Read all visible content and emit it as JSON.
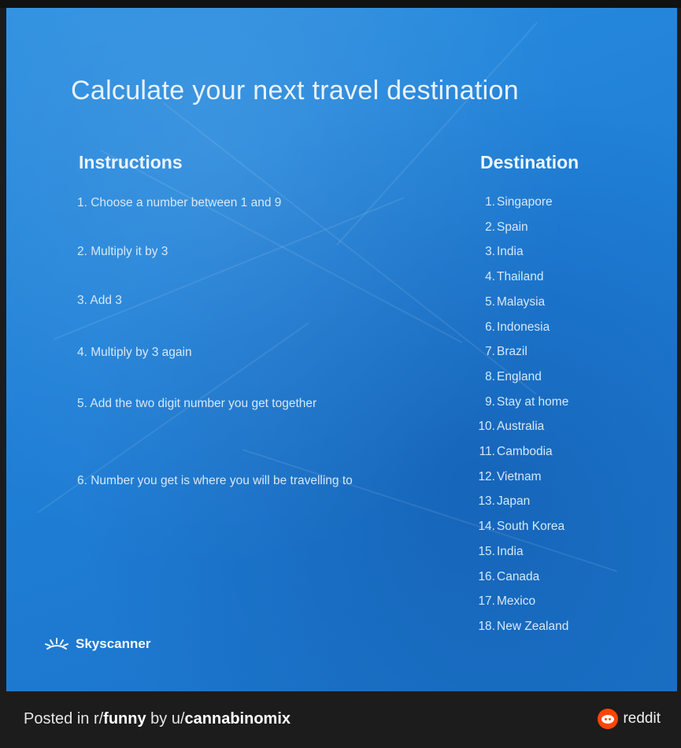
{
  "poster": {
    "title": "Calculate your next travel destination",
    "instructions_heading": "Instructions",
    "destination_heading": "Destination",
    "instructions": [
      "1. Choose a number between 1 and 9",
      "2.  Multiply it by 3",
      "3. Add 3",
      "4. Multiply by 3 again",
      " 5. Add the two digit number you get together",
      " 6. Number you get is where you will be travelling to"
    ],
    "destinations": [
      {
        "num": "1.",
        "name": "Singapore"
      },
      {
        "num": "2.",
        "name": "Spain"
      },
      {
        "num": "3.",
        "name": "India"
      },
      {
        "num": "4.",
        "name": "Thailand"
      },
      {
        "num": "5.",
        "name": "Malaysia"
      },
      {
        "num": "6.",
        "name": "Indonesia"
      },
      {
        "num": "7.",
        "name": "Brazil"
      },
      {
        "num": "8.",
        "name": "England"
      },
      {
        "num": "9.",
        "name": "Stay at home"
      },
      {
        "num": "10.",
        "name": "Australia"
      },
      {
        "num": "11.",
        "name": "Cambodia"
      },
      {
        "num": "12.",
        "name": "Vietnam"
      },
      {
        "num": "13.",
        "name": "Japan"
      },
      {
        "num": "14.",
        "name": "South Korea"
      },
      {
        "num": "15.",
        "name": "India"
      },
      {
        "num": "16.",
        "name": "Canada"
      },
      {
        "num": "17.",
        "name": "Mexico"
      },
      {
        "num": "18.",
        "name": "New Zealand"
      }
    ],
    "brand": "Skyscanner",
    "brand_icon": "skyscanner-sunrise-icon",
    "background_color": "#1f7fd6",
    "text_color": "#d6e8f8"
  },
  "footer": {
    "posted_prefix": "Posted in r/",
    "subreddit": "funny",
    "by_text": " by u/",
    "username": "cannabinomix",
    "platform_label": "reddit",
    "platform_icon": "reddit-logo-icon",
    "platform_color": "#ff4500"
  }
}
